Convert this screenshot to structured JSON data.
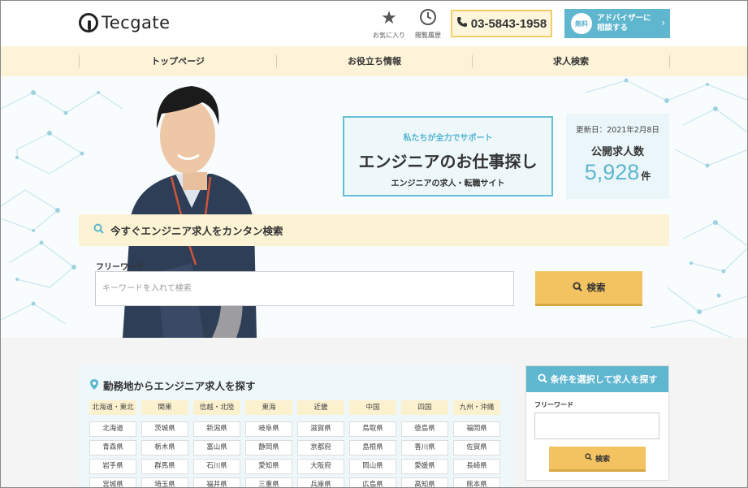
{
  "header": {
    "logo_text": "Tecgate",
    "favorites_label": "お気に入り",
    "history_label": "閲覧履歴",
    "phone": "03-5843-1958",
    "advisor_badge": "無料",
    "advisor_line1": "アドバイザーに",
    "advisor_line2": "相談する"
  },
  "nav": {
    "items": [
      {
        "label": "トップページ"
      },
      {
        "label": "お役立ち情報"
      },
      {
        "label": "求人検索"
      }
    ]
  },
  "hero": {
    "catch_sub": "私たちが全力でサポート",
    "catch_main": "エンジニアのお仕事探し",
    "catch_tag": "エンジニアの求人・転職サイト",
    "updated": "更新日：2021年2月8日",
    "count_title": "公開求人数",
    "count_value": "5,928",
    "count_unit": "件",
    "search_title": "今すぐエンジニア求人をカンタン検索",
    "freeword_label": "フリーワード",
    "freeword_placeholder": "キーワードを入れて検索",
    "search_button": "検索"
  },
  "area": {
    "title": "勤務地からエンジニア求人を探す",
    "regions": [
      "北海道・東北",
      "関東",
      "信越・北陸",
      "東海",
      "近畿",
      "中国",
      "四国",
      "九州・沖縄"
    ],
    "rows": [
      [
        "北海道",
        "茨城県",
        "新潟県",
        "岐阜県",
        "滋賀県",
        "鳥取県",
        "徳島県",
        "福岡県"
      ],
      [
        "青森県",
        "栃木県",
        "富山県",
        "静岡県",
        "京都府",
        "島根県",
        "香川県",
        "佐賀県"
      ],
      [
        "岩手県",
        "群馬県",
        "石川県",
        "愛知県",
        "大阪府",
        "岡山県",
        "愛媛県",
        "長崎県"
      ],
      [
        "宮城県",
        "埼玉県",
        "福井県",
        "三重県",
        "兵庫県",
        "広島県",
        "高知県",
        "熊本県"
      ]
    ]
  },
  "side": {
    "title": "条件を選択して求人を探す",
    "freeword_label": "フリーワード",
    "button": "検索"
  },
  "colors": {
    "accent": "#5fb6cf",
    "cta": "#f3c361",
    "nav_bg": "#fcf3d8"
  }
}
